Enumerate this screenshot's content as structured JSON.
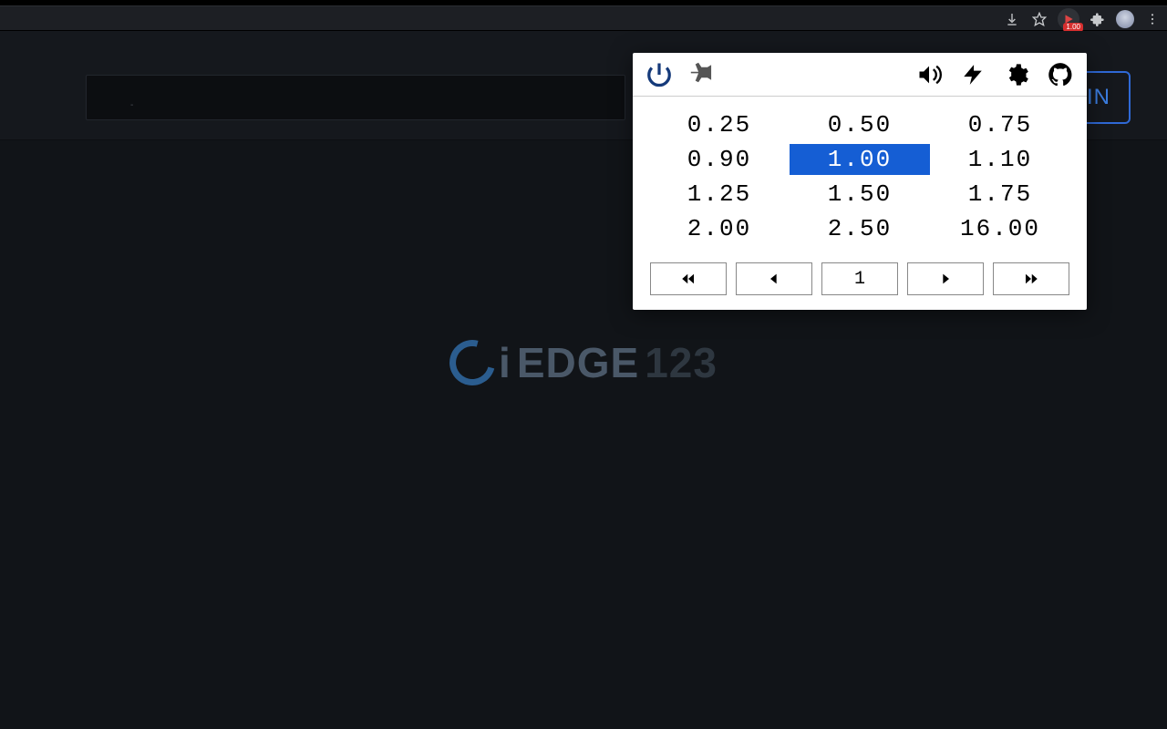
{
  "browser": {
    "ext_badge_label": "1.00"
  },
  "header": {
    "search_placeholder": "",
    "search_dash": "-",
    "in_button": "IN"
  },
  "logo": {
    "i": "i",
    "edge": "EDGE",
    "num": "123"
  },
  "popup": {
    "speeds": [
      "0.25",
      "0.50",
      "0.75",
      "0.90",
      "1.00",
      "1.10",
      "1.25",
      "1.50",
      "1.75",
      "2.00",
      "2.50",
      "16.00"
    ],
    "selected_index": 4,
    "step_value": "1"
  }
}
